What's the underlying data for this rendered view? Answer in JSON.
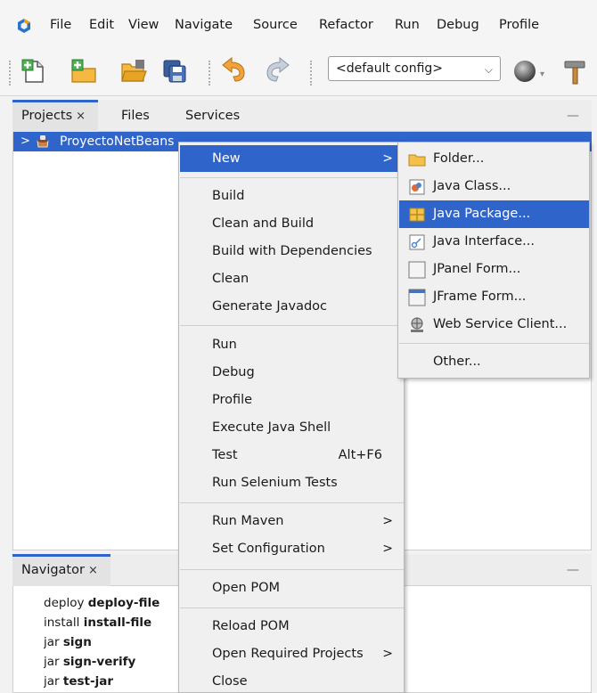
{
  "menubar": {
    "items": [
      "File",
      "Edit",
      "View",
      "Navigate",
      "Source",
      "Refactor",
      "Run",
      "Debug",
      "Profile"
    ]
  },
  "toolbar": {
    "config_value": "<default config>",
    "icons": [
      "new-file-icon",
      "new-project-icon",
      "open-project-icon",
      "save-all-icon",
      "undo-icon",
      "redo-icon",
      "globe-icon",
      "hammer-icon"
    ]
  },
  "projects_panel": {
    "tabs": [
      "Projects",
      "Files",
      "Services"
    ],
    "close_glyph": "×",
    "minimize_glyph": "—",
    "project_name": "ProyectoNetBeans"
  },
  "navigator_panel": {
    "tab": "Navigator",
    "close_glyph": "×",
    "minimize_glyph": "—",
    "rows": [
      {
        "prefix": "deploy ",
        "bold": "deploy-file"
      },
      {
        "prefix": "install ",
        "bold": "install-file"
      },
      {
        "prefix": "jar ",
        "bold": "sign"
      },
      {
        "prefix": "jar ",
        "bold": "sign-verify"
      },
      {
        "prefix": "jar ",
        "bold": "test-jar"
      }
    ]
  },
  "context_menu": {
    "new": "New",
    "group1": [
      "Build",
      "Clean and Build",
      "Build with Dependencies",
      "Clean",
      "Generate Javadoc"
    ],
    "group2": [
      "Run",
      "Debug",
      "Profile",
      "Execute Java Shell",
      "Test",
      "Run Selenium Tests"
    ],
    "test_shortcut": "Alt+F6",
    "group3": [
      "Run Maven",
      "Set Configuration"
    ],
    "group4": [
      "Open POM"
    ],
    "group5": [
      "Reload POM",
      "Open Required Projects",
      "Close"
    ],
    "arrow_glyph": ">"
  },
  "submenu": {
    "items": [
      "Folder...",
      "Java Class...",
      "Java Package...",
      "Java Interface...",
      "JPanel Form...",
      "JFrame Form...",
      "Web Service Client..."
    ],
    "other": "Other..."
  },
  "colors": {
    "selection": "#2f65ca",
    "menu_bg": "#f0f0f0"
  }
}
